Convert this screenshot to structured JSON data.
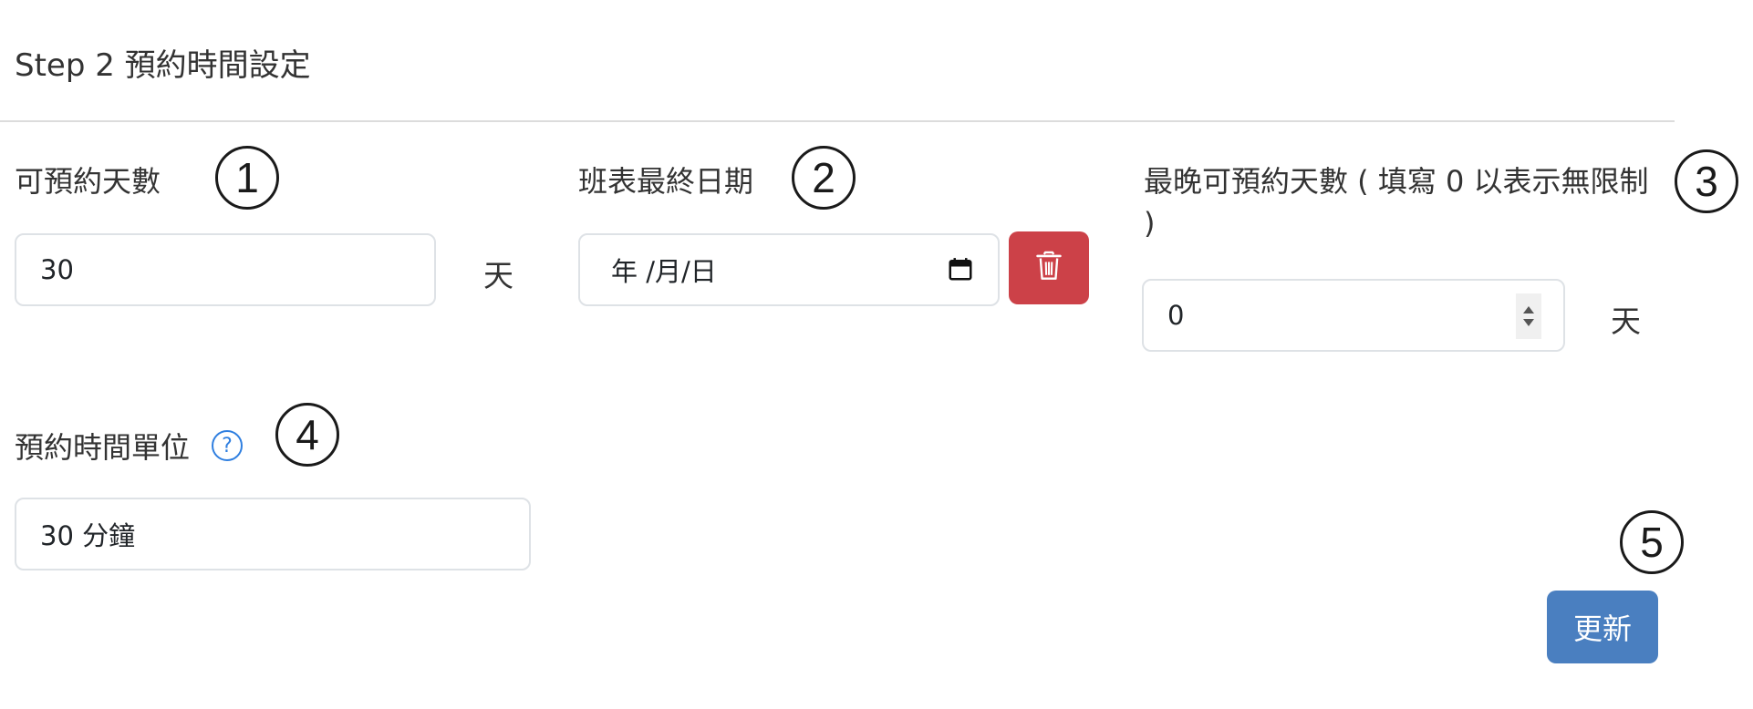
{
  "section": {
    "title": "Step 2 預約時間設定"
  },
  "bookable_days": {
    "label": "可預約天數",
    "value": "30",
    "unit": "天",
    "badge": "1"
  },
  "schedule_end_date": {
    "label": "班表最終日期",
    "placeholder": "年 /月/日",
    "badge": "2"
  },
  "latest_bookable_days": {
    "label_line1": "最晚可預約天數 ( 填寫 0 以表示無限制",
    "label_line2": ")",
    "value": "0",
    "unit": "天",
    "badge": "3"
  },
  "time_unit": {
    "label": "預約時間單位",
    "help_icon": "question-circle-icon",
    "value": "30 分鐘",
    "badge": "4"
  },
  "actions": {
    "update_label": "更新",
    "badge": "5"
  },
  "colors": {
    "danger": "#cc4148",
    "primary": "#4a7fc0",
    "help": "#2f7fe0"
  }
}
